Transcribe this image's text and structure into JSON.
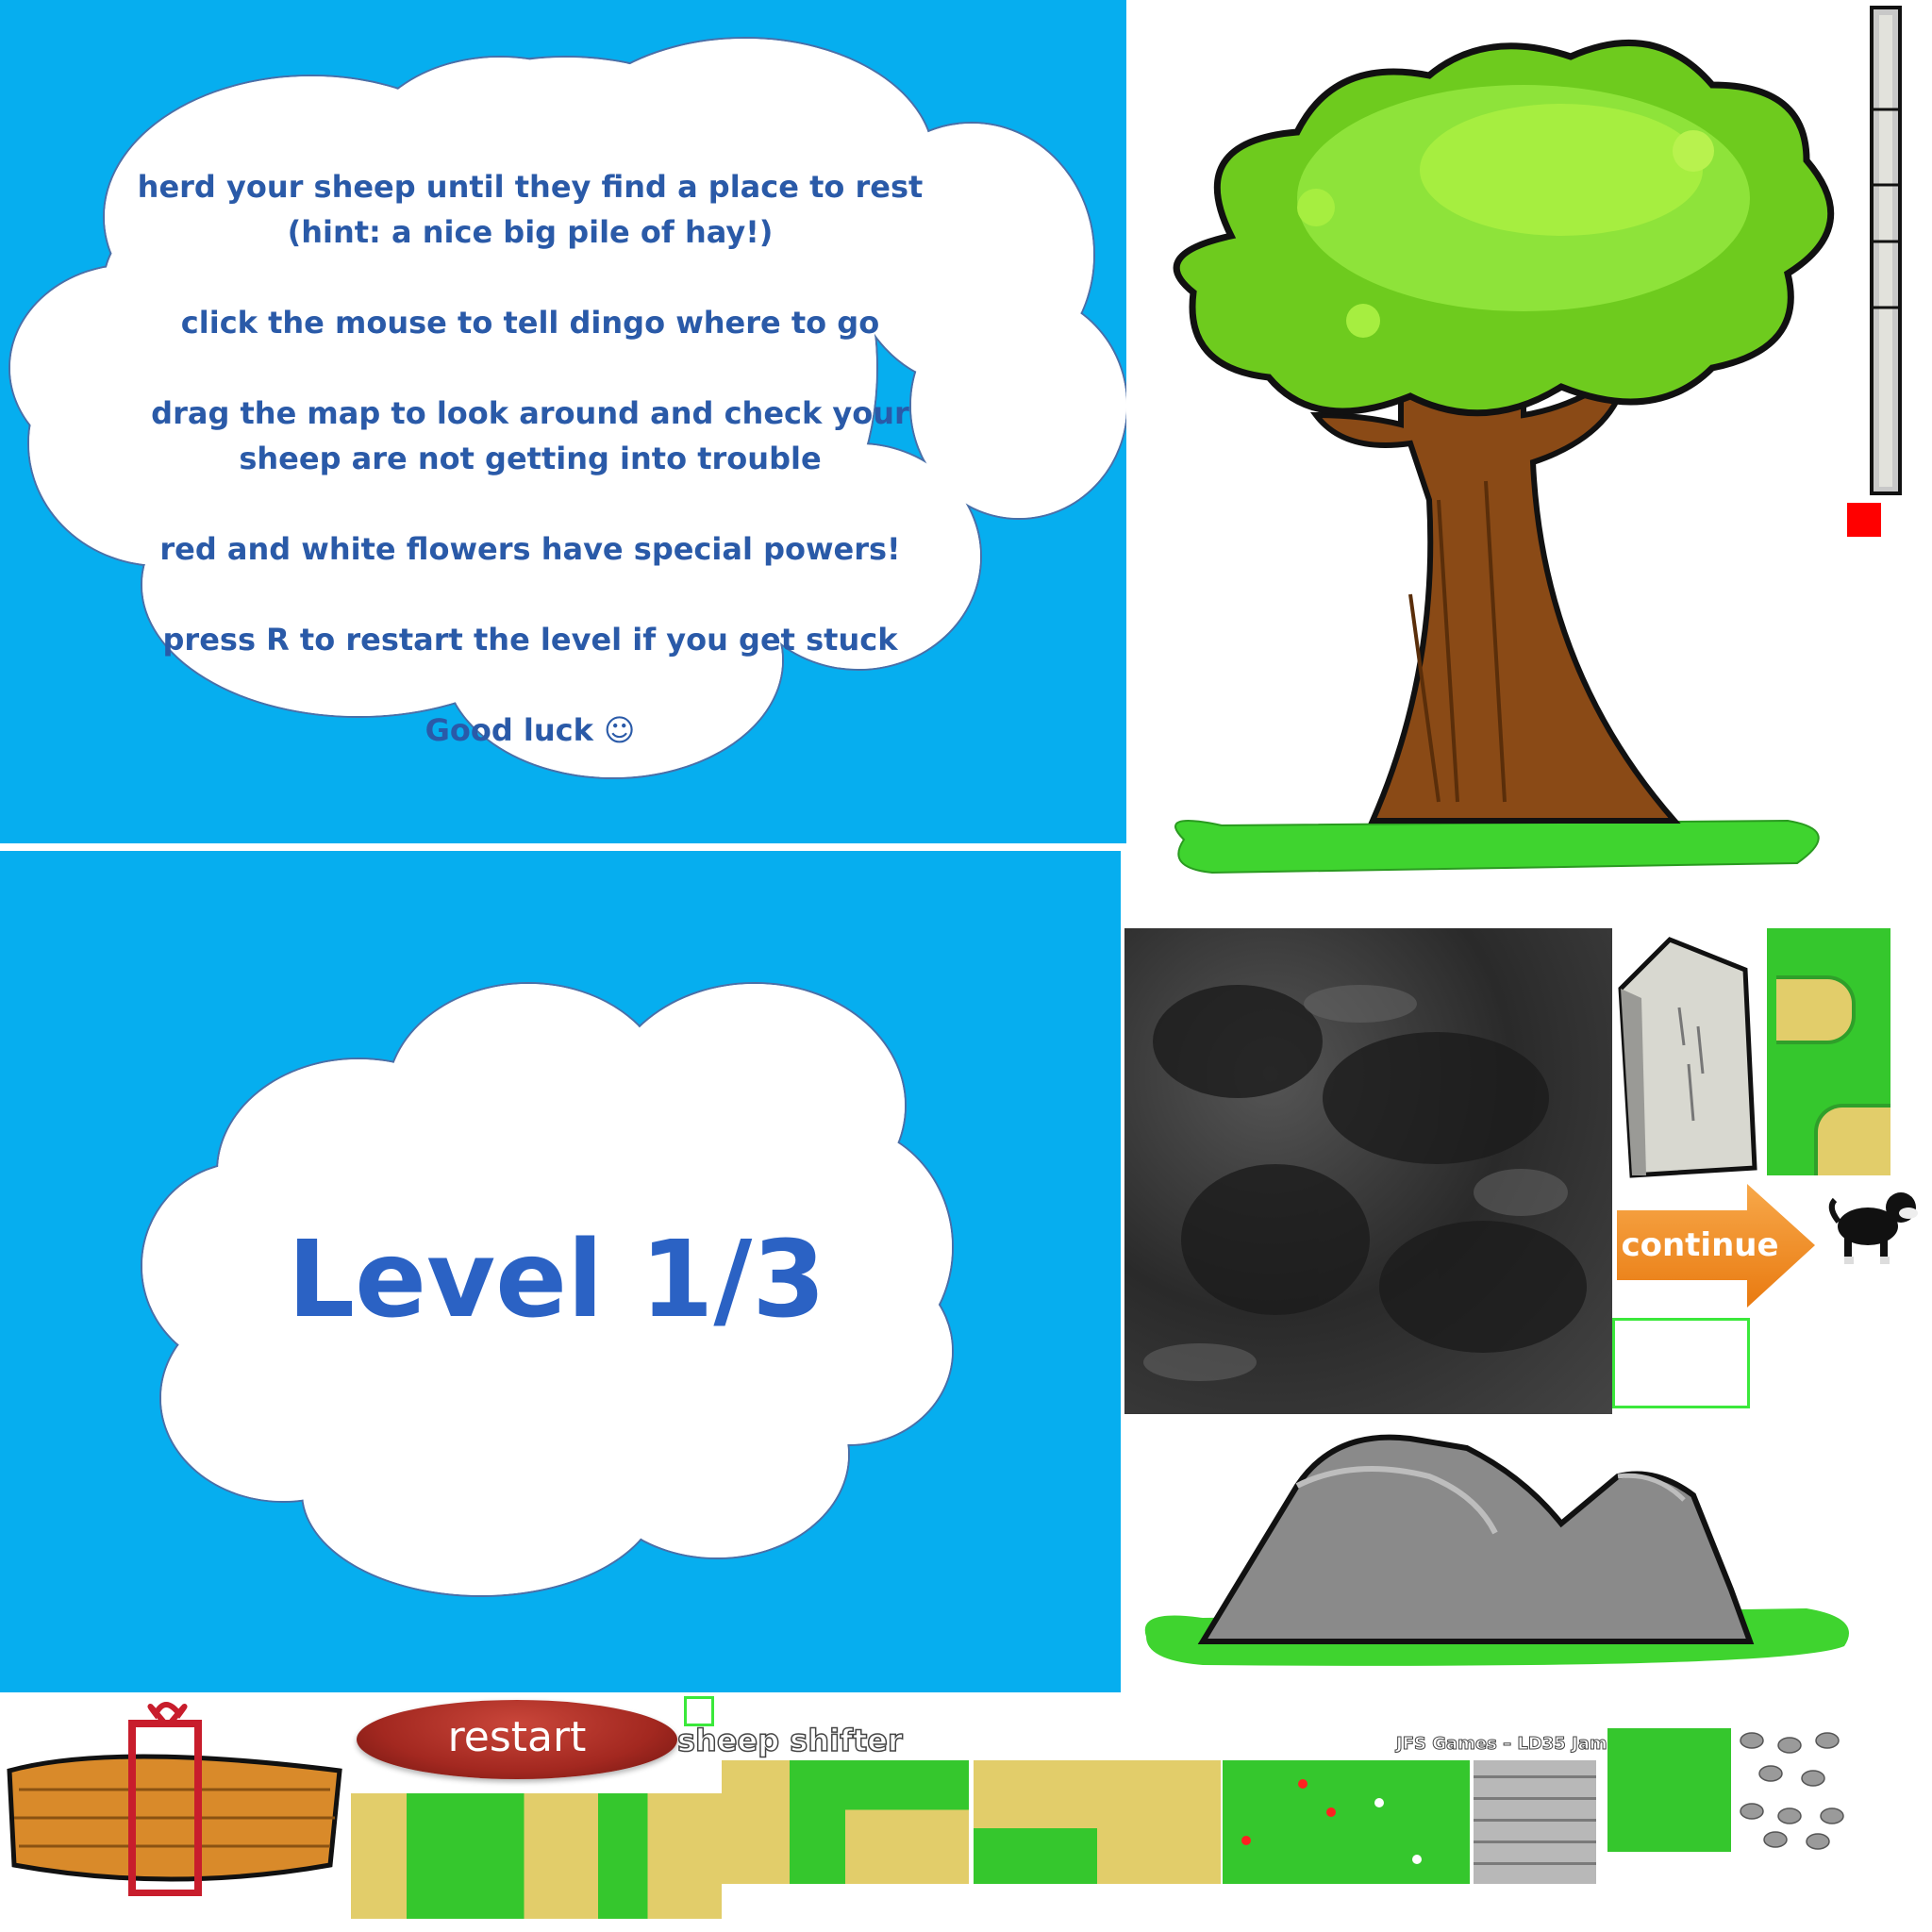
{
  "instructions": {
    "lines": [
      "herd your sheep until they find a place to rest",
      "(hint: a nice big pile of hay!)",
      "",
      "click the mouse to tell dingo where to go",
      "",
      "drag the map to look around and check your",
      "sheep are not getting into trouble",
      "",
      "red and white flowers have special powers!",
      "",
      "press R to restart the level if you get stuck",
      "",
      "Good luck ☺"
    ]
  },
  "level": {
    "label": "Level 1/3"
  },
  "buttons": {
    "continue": "continue",
    "restart": "restart"
  },
  "labels": {
    "game_title": "sheep shifter",
    "credit": "JFS Games – LD35 Jam"
  },
  "colors": {
    "sky": "#06aeef",
    "cloud_text": "#2a5aa8",
    "grass": "#35c72d",
    "sand": "#e2cd6a",
    "continue": "#f08a1c",
    "restart": "#a32820"
  }
}
